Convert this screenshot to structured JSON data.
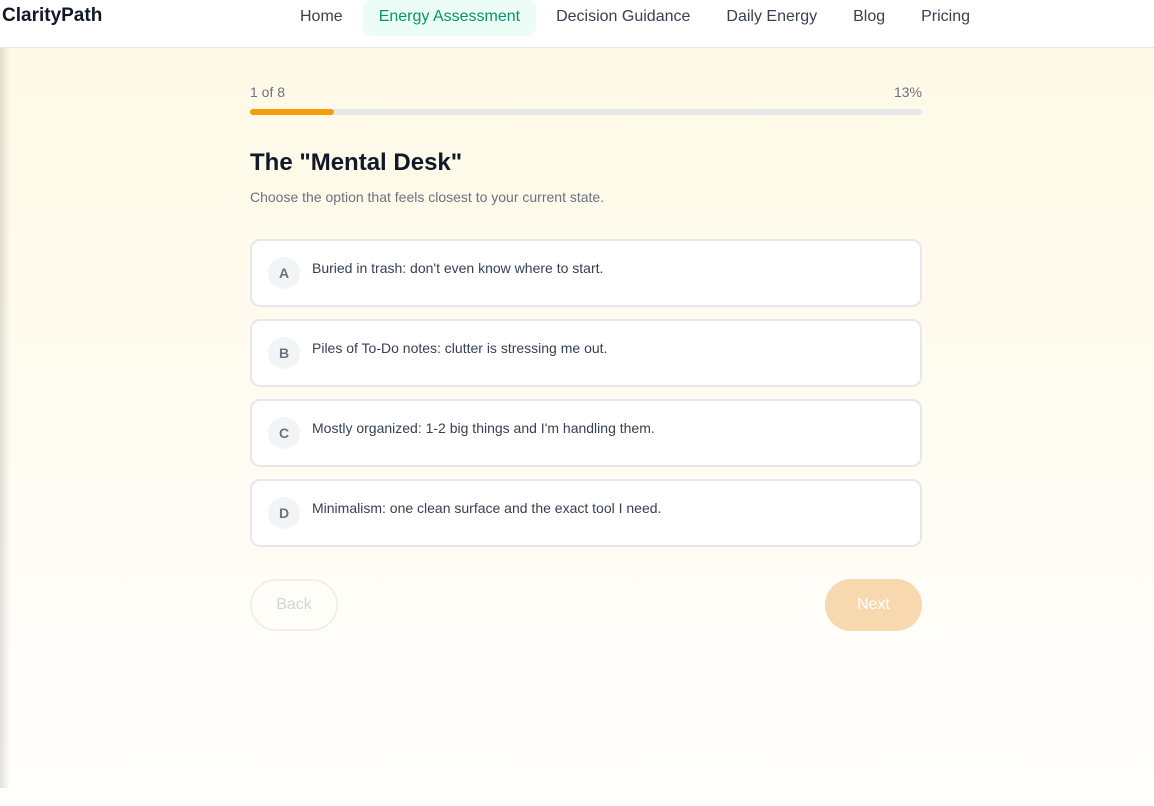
{
  "header": {
    "logo": "ClarityPath",
    "nav": [
      {
        "label": "Home",
        "active": false
      },
      {
        "label": "Energy Assessment",
        "active": true
      },
      {
        "label": "Decision Guidance",
        "active": false
      },
      {
        "label": "Daily Energy",
        "active": false
      },
      {
        "label": "Blog",
        "active": false
      },
      {
        "label": "Pricing",
        "active": false
      }
    ]
  },
  "progress": {
    "step_text": "1 of 8",
    "percent_text": "13%",
    "value": 0.125
  },
  "question": {
    "title": "The \"Mental Desk\"",
    "subtitle": "Choose the option that feels closest to your current state."
  },
  "options": [
    {
      "letter": "A",
      "text": "Buried in trash: don't even know where to start."
    },
    {
      "letter": "B",
      "text": "Piles of To-Do notes: clutter is stressing me out."
    },
    {
      "letter": "C",
      "text": "Mostly organized: 1-2 big things and I'm handling them."
    },
    {
      "letter": "D",
      "text": "Minimalism: one clean surface and the exact tool I need."
    }
  ],
  "buttons": {
    "back": "Back",
    "next": "Next"
  },
  "colors": {
    "accent": "#f59e0b",
    "nav_active": "#059669",
    "nav_active_bg": "#ecfdf5"
  }
}
